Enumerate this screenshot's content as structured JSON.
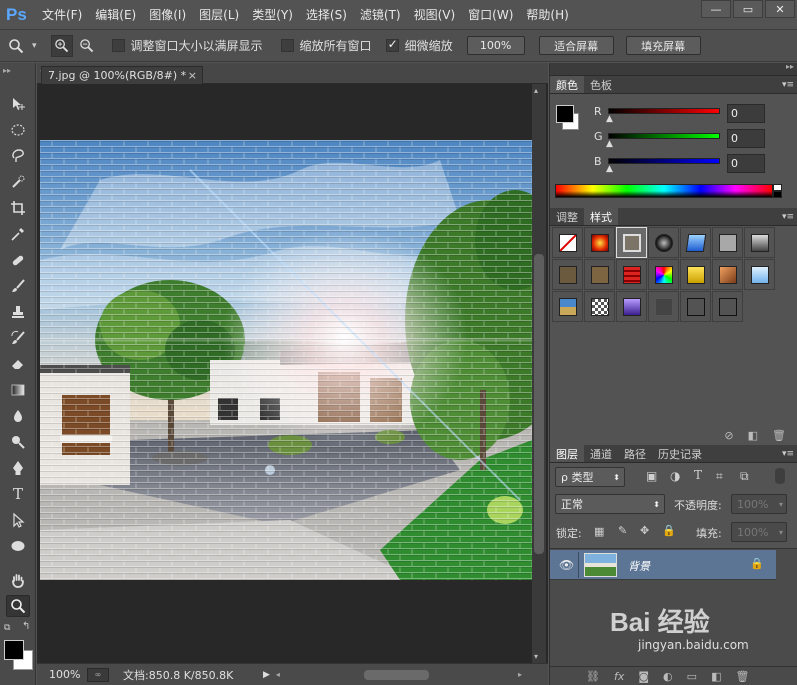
{
  "app": {
    "logo": "Ps"
  },
  "menus": [
    "文件(F)",
    "编辑(E)",
    "图像(I)",
    "图层(L)",
    "类型(Y)",
    "选择(S)",
    "滤镜(T)",
    "视图(V)",
    "窗口(W)",
    "帮助(H)"
  ],
  "window_controls": {
    "minimize": "—",
    "restore": "▭",
    "close": "✕"
  },
  "options": {
    "resize_windows_label": "调整窗口大小以满屏显示",
    "resize_windows_checked": false,
    "zoom_all_label": "缩放所有窗口",
    "zoom_all_checked": false,
    "scrubby_label": "细微缩放",
    "scrubby_checked": true,
    "zoom_percent_btn": "100%",
    "fit_screen_btn": "适合屏幕",
    "fill_screen_btn": "填充屏幕"
  },
  "document": {
    "tab_title": "7.jpg @ 100%(RGB/8#) *",
    "tab_close": "×",
    "zoom_status": "100%",
    "doc_info": "文档:850.8 K/850.8K"
  },
  "color_panel": {
    "tabs": [
      "颜色",
      "色板"
    ],
    "channels": [
      {
        "label": "R",
        "value": "0",
        "gradient_end": "#ff0000"
      },
      {
        "label": "G",
        "value": "0",
        "gradient_end": "#00ff00"
      },
      {
        "label": "B",
        "value": "0",
        "gradient_end": "#0000ff"
      }
    ]
  },
  "styles_panel": {
    "tabs": [
      "调整",
      "样式"
    ]
  },
  "layers_panel": {
    "tabs": [
      "图层",
      "通道",
      "路径",
      "历史记录"
    ],
    "filter_label": "ρ 类型",
    "blend_mode": "正常",
    "opacity_label": "不透明度:",
    "opacity_value": "100%",
    "lock_label": "锁定:",
    "fill_label": "填充:",
    "fill_value": "100%",
    "layers": [
      {
        "name": "背景",
        "locked": true,
        "visible": true
      }
    ]
  },
  "watermark": {
    "brand": "Bai 经验",
    "url": "jingyan.baidu.com"
  }
}
